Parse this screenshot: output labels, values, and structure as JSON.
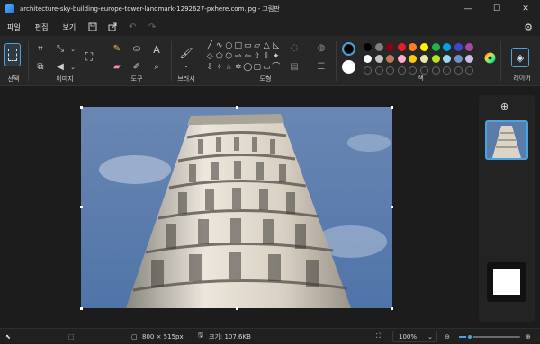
{
  "window": {
    "title": "architecture-sky-building-europe-tower-landmark-1292627-pxhere.com.jpg - 그림판",
    "controls": [
      "—",
      "☐",
      "✕"
    ]
  },
  "menu": {
    "items": [
      "파일",
      "편집",
      "보기"
    ],
    "icons": [
      "save-icon",
      "share-icon",
      "undo-icon",
      "redo-icon",
      "settings-icon"
    ]
  },
  "ribbon": {
    "groups": {
      "select": "선택",
      "image": "이미지",
      "tools": "도구",
      "brushes": "브러시",
      "shapes": "도형",
      "colors": "색",
      "layers": "레이어"
    },
    "shape_glyphs": [
      "╱",
      "∿",
      "○",
      "□",
      "▭",
      "▱",
      "△",
      "◺",
      "◇",
      "⬠",
      "⬡",
      "⇨",
      "⇦",
      "⇧",
      "⇩",
      "✦",
      "⇩",
      "✧",
      "☆",
      "✡",
      "◯",
      "▢",
      "▭",
      "⌒"
    ],
    "primary_color": "#000000",
    "secondary_color": "#ffffff",
    "palette": [
      "#000000",
      "#7f7f7f",
      "#880015",
      "#ed1c24",
      "#ff7f27",
      "#fff200",
      "#22b14c",
      "#00a2e8",
      "#3f48cc",
      "#a349a4",
      "#ffffff",
      "#c3c3c3",
      "#b97a57",
      "#ffaec9",
      "#ffc90e",
      "#efe4b0",
      "#b5e61d",
      "#99d9ea",
      "#7092be",
      "#c8bfe7",
      "#ffffff",
      "#ffffff",
      "#ffffff",
      "#ffffff",
      "#ffffff",
      "#ffffff",
      "#ffffff",
      "#ffffff",
      "#ffffff",
      "#ffffff"
    ]
  },
  "status": {
    "image_size": "800 × 515px",
    "file_size": "크기: 107.6KB",
    "zoom": "100%",
    "zoom_fraction": 0.18
  }
}
